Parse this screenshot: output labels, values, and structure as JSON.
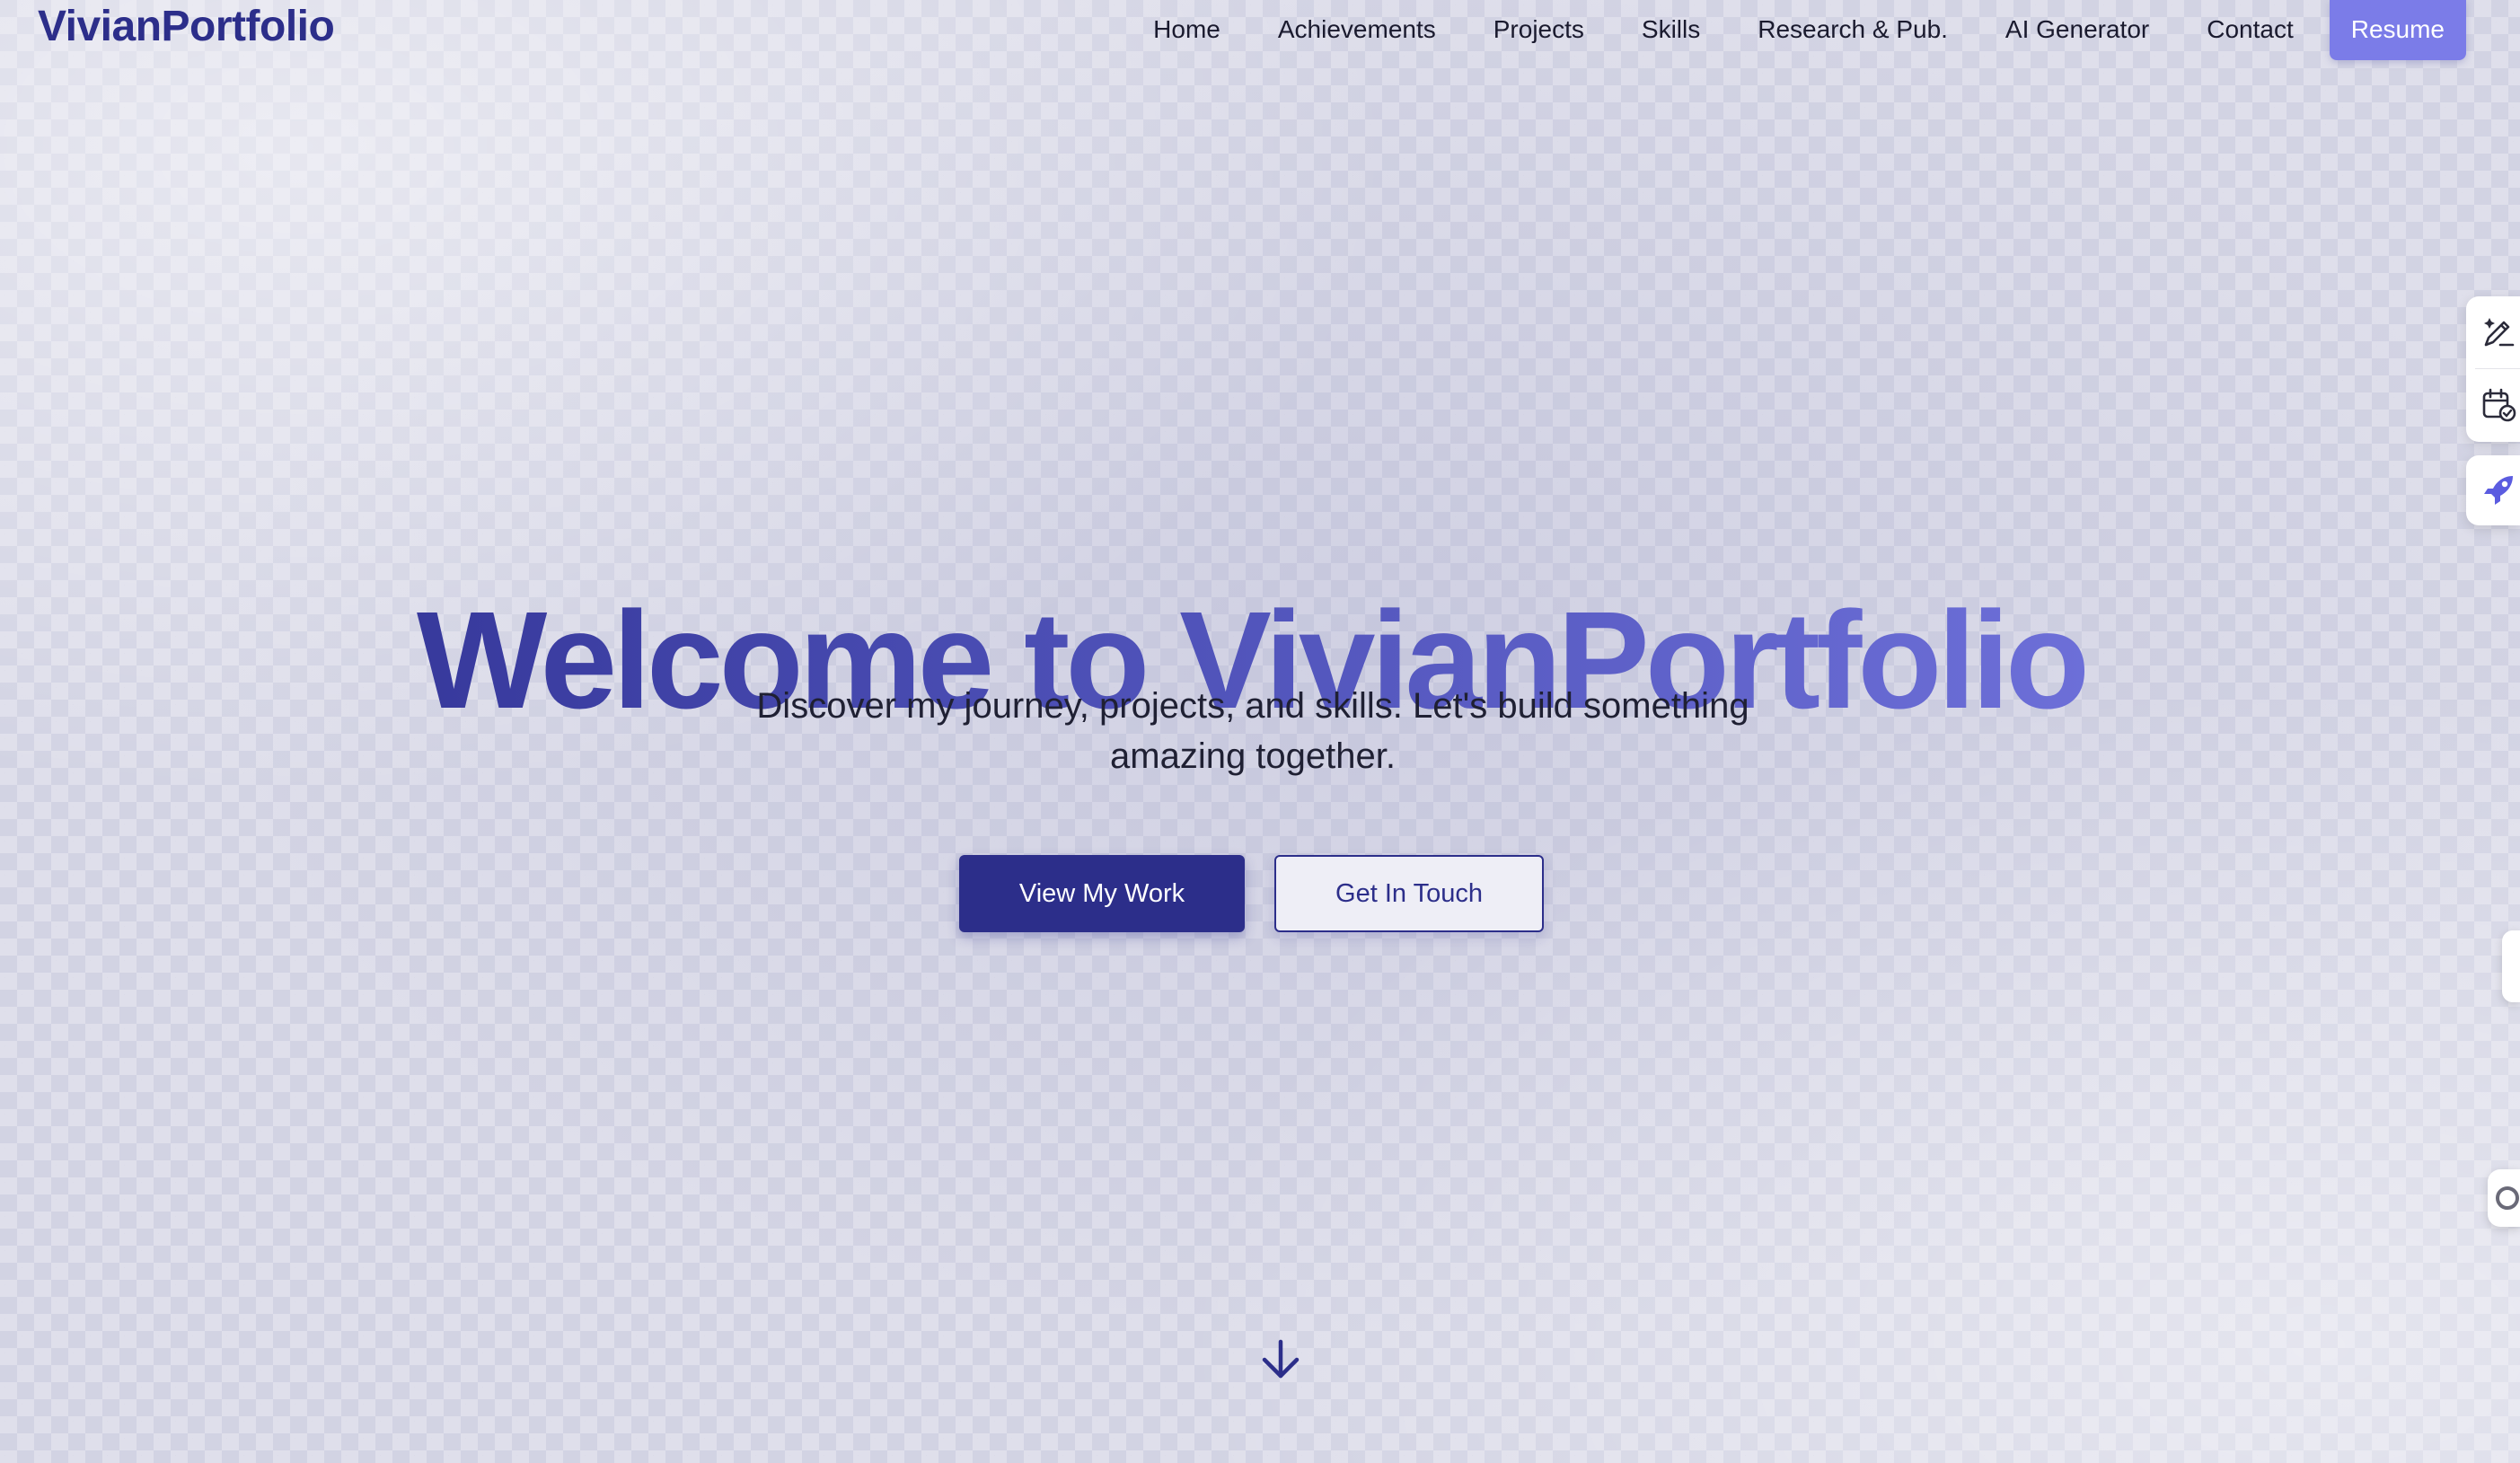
{
  "brand": {
    "name": "VivianPortfolio"
  },
  "nav": {
    "links": [
      "Home",
      "Achievements",
      "Projects",
      "Skills",
      "Research & Pub.",
      "AI Generator",
      "Contact"
    ],
    "resume_label": "Resume"
  },
  "hero": {
    "title": "Welcome to VivianPortfolio",
    "subtitle_line1": "Discover my journey, projects, and skills. Let's build something",
    "subtitle_line2": "amazing together.",
    "primary_cta": "View My Work",
    "secondary_cta": "Get In Touch"
  },
  "icons": {
    "scroll": "arrow-down-icon",
    "side_tools": [
      "pen-sparkle-icon",
      "calendar-check-icon",
      "rocket-icon",
      "drawer-tab-icon",
      "circle-toggle-icon"
    ]
  },
  "colors": {
    "brand": "#2c2e8a",
    "accent": "#7b7ce8",
    "gradient_end": "#7a7ce6",
    "background": "#d2d3e3"
  }
}
